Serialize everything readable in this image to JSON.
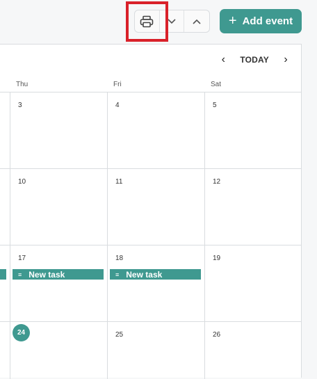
{
  "toolbar": {
    "print_icon": "printer-icon",
    "down_icon": "chevron-down-icon",
    "up_icon": "chevron-up-icon",
    "add_event_label": "Add event",
    "add_event_icon": "+"
  },
  "calendar_nav": {
    "prev_icon": "‹",
    "today_label": "TODAY",
    "next_icon": "›"
  },
  "days_of_week": [
    "Thu",
    "Fri",
    "Sat"
  ],
  "weeks": [
    [
      "3",
      "4",
      "5"
    ],
    [
      "10",
      "11",
      "12"
    ],
    [
      "17",
      "18",
      "19"
    ],
    [
      "24",
      "25",
      "26"
    ]
  ],
  "tasks": [
    {
      "title": "New task",
      "icon": "≡"
    },
    {
      "title": "New task",
      "icon": "≡"
    }
  ],
  "colors": {
    "accent": "#3f9990",
    "highlight": "#d9212a"
  }
}
